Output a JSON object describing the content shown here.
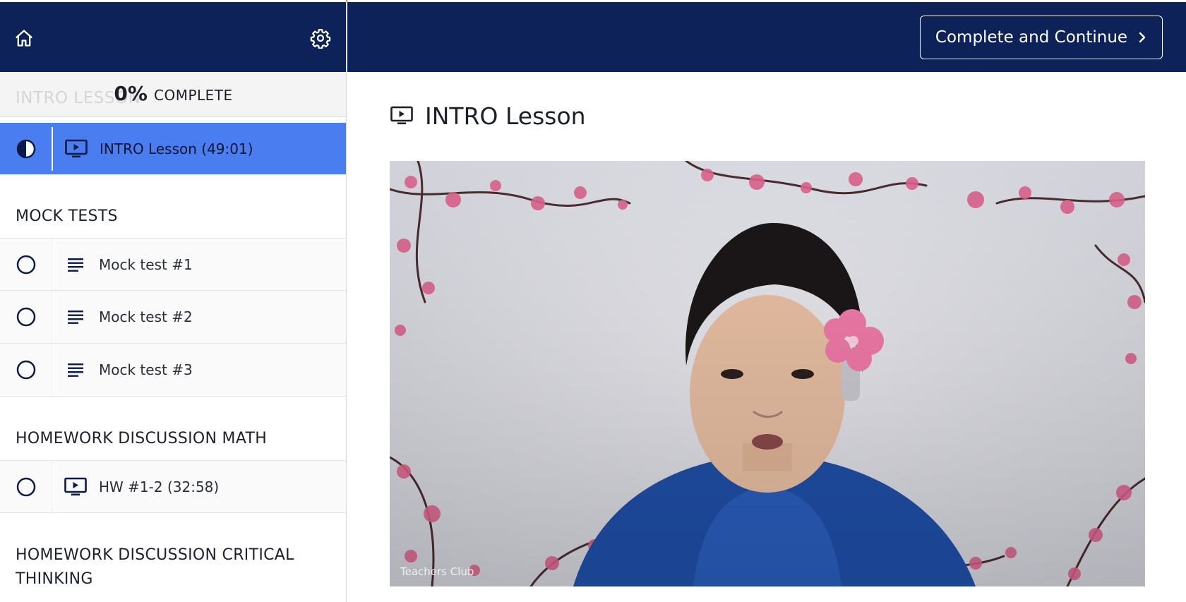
{
  "header": {
    "continue_label": "Complete and Continue"
  },
  "progress": {
    "percent": "0%",
    "label": "COMPLETE",
    "ghost_section": "INTRO LESSON"
  },
  "sidebar": {
    "active_lecture": {
      "title": "INTRO Lesson (49:01)",
      "type": "video",
      "status": "in-progress"
    },
    "sections": [
      {
        "title": "MOCK TESTS",
        "lectures": [
          {
            "title": "Mock test #1",
            "type": "text",
            "status": "incomplete"
          },
          {
            "title": "Mock test #2",
            "type": "text",
            "status": "incomplete"
          },
          {
            "title": "Mock test #3",
            "type": "text",
            "status": "incomplete"
          }
        ]
      },
      {
        "title": "HOMEWORK DISCUSSION MATH",
        "lectures": [
          {
            "title": "HW #1-2 (32:58)",
            "type": "video",
            "status": "incomplete"
          }
        ]
      },
      {
        "title": "HOMEWORK DISCUSSION CRITICAL THINKING",
        "lectures": []
      }
    ]
  },
  "main": {
    "lesson_title": "INTRO Lesson",
    "video_watermark": "Teachers Club"
  },
  "colors": {
    "header_bg": "#0c2259",
    "active_row": "#4a7ef0",
    "icon_dark": "#0c1a4a"
  }
}
